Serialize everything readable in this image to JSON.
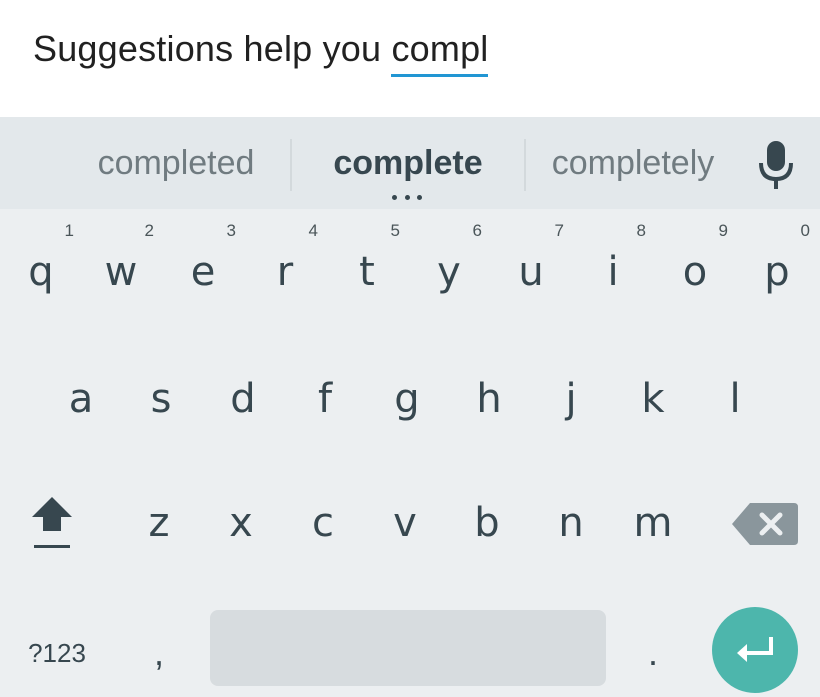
{
  "text_field": {
    "prefix": "Suggestions help you ",
    "composing": "compl"
  },
  "suggestions": {
    "left": "completed",
    "center": "complete",
    "right": "completely",
    "mic_icon": "microphone-icon"
  },
  "keyboard": {
    "row1": [
      {
        "key": "q",
        "hint": "1"
      },
      {
        "key": "w",
        "hint": "2"
      },
      {
        "key": "e",
        "hint": "3"
      },
      {
        "key": "r",
        "hint": "4"
      },
      {
        "key": "t",
        "hint": "5"
      },
      {
        "key": "y",
        "hint": "6"
      },
      {
        "key": "u",
        "hint": "7"
      },
      {
        "key": "i",
        "hint": "8"
      },
      {
        "key": "o",
        "hint": "9"
      },
      {
        "key": "p",
        "hint": "0"
      }
    ],
    "row2": [
      "a",
      "s",
      "d",
      "f",
      "g",
      "h",
      "j",
      "k",
      "l"
    ],
    "row3": [
      "z",
      "x",
      "c",
      "v",
      "b",
      "n",
      "m"
    ],
    "symbols_label": "?123",
    "comma": ",",
    "period": ".",
    "shift_icon": "shift-icon",
    "backspace_icon": "backspace-icon",
    "enter_icon": "enter-icon",
    "colors": {
      "background": "#eceff1",
      "suggestion_strip": "#e3e8eb",
      "key_text": "#37474f",
      "accent_underline": "#2196d3",
      "enter_button": "#4db6ac"
    }
  }
}
